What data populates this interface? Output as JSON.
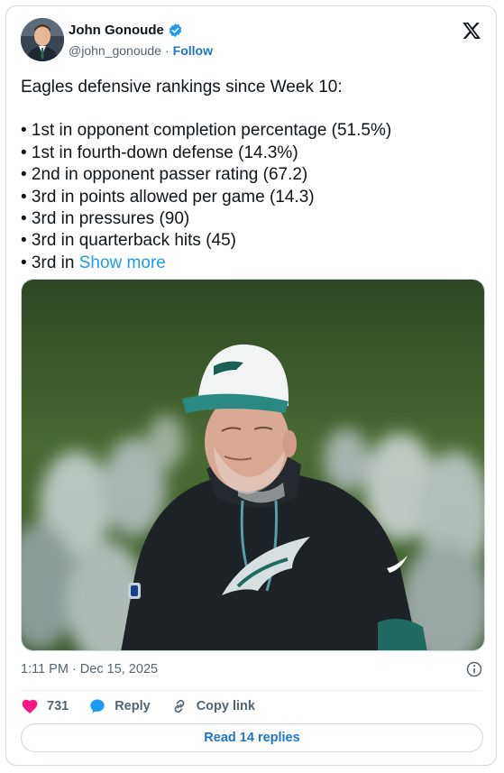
{
  "author": {
    "name": "John Gonoude",
    "handle": "@john_gonoude",
    "separator": "·",
    "follow_label": "Follow",
    "verified": true
  },
  "tweet": {
    "intro": "Eagles defensive rankings since Week 10:",
    "bullets": [
      "• 1st in opponent completion percentage (51.5%)",
      "• 1st in fourth-down defense (14.3%)",
      "• 2nd in opponent passer rating (67.2)",
      "• 3rd in points allowed per game (14.3)",
      "• 3rd in pressures (90)",
      "• 3rd in quarterback hits (45)"
    ],
    "last_bullet_prefix": "• 3rd in ",
    "show_more_label": "Show more"
  },
  "meta": {
    "timestamp": "1:11 PM · Dec 15, 2025"
  },
  "actions": {
    "likes": "731",
    "reply_label": "Reply",
    "copy_link_label": "Copy link"
  },
  "read_replies_label": "Read 14 replies",
  "colors": {
    "link": "#1d9bf0",
    "heart": "#f91880",
    "reply_icon": "#1d9bf0",
    "verified": "#1d9bf0",
    "border": "#cfd9de"
  }
}
